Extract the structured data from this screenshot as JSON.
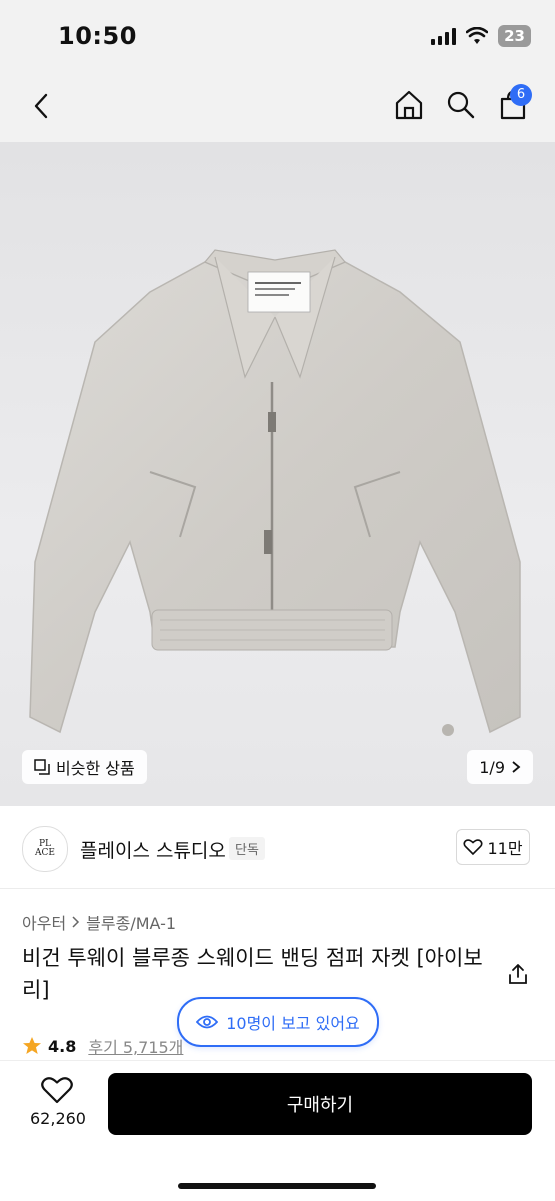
{
  "status_bar": {
    "time": "10:50",
    "battery": "23"
  },
  "nav": {
    "cart_badge": "6"
  },
  "gallery": {
    "similar_label": "비슷한 상품",
    "page_indicator": "1/9"
  },
  "brand": {
    "name": "플레이스 스튜디오",
    "tag": "단독",
    "likes": "11만",
    "logo_text": "PLACE STUDIO"
  },
  "product": {
    "breadcrumb": [
      "아우터",
      "블루종/MA-1"
    ],
    "title": "비건 투웨이 블루종 스웨이드 밴딩 점퍼 자켓 [아이보리]",
    "rating": "4.8",
    "reviews": "후기 5,715개",
    "viewers": "10명이 보고 있어요"
  },
  "bottom_bar": {
    "wish_count": "62,260",
    "buy_label": "구매하기"
  },
  "colors": {
    "accent": "#2f6df6",
    "buy_button": "#000000",
    "star": "#f5a623"
  }
}
